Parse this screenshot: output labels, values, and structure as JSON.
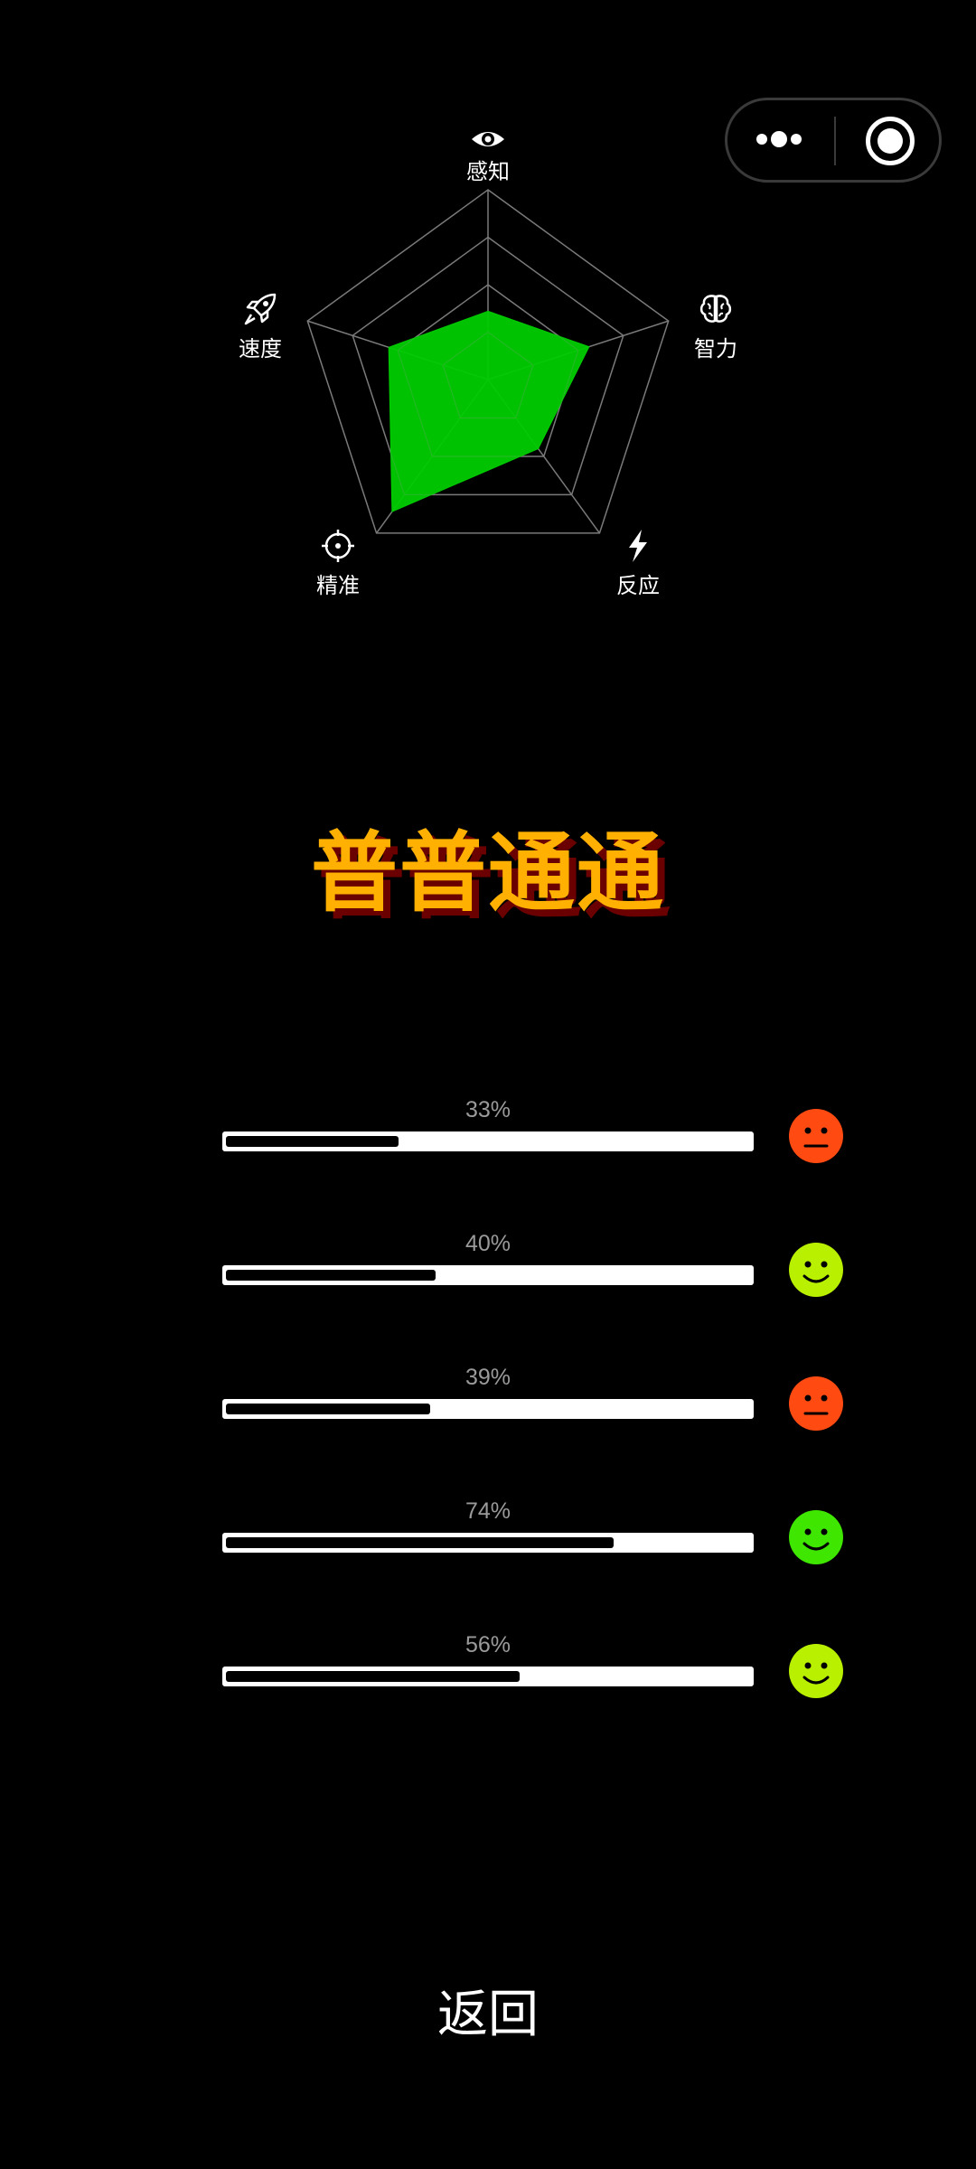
{
  "radar": {
    "axes": [
      {
        "label": "感知",
        "icon": "eye-icon",
        "value": 0.36
      },
      {
        "label": "智力",
        "icon": "brain-icon",
        "value": 0.56
      },
      {
        "label": "反应",
        "icon": "lightning-icon",
        "value": 0.45
      },
      {
        "label": "精准",
        "icon": "target-icon",
        "value": 0.86
      },
      {
        "label": "速度",
        "icon": "rocket-icon",
        "value": 0.55
      }
    ],
    "fill_color": "#00cc00",
    "grid_color": "#7a7a7a",
    "grid_levels": 4
  },
  "headline": "普普通通",
  "headline_color": "#ffb000",
  "rows": [
    {
      "percent_label": "33%",
      "value": 0.33,
      "mood": "neutral-face-icon",
      "mood_color": "#ff4a12"
    },
    {
      "percent_label": "40%",
      "value": 0.4,
      "mood": "smile-face-icon",
      "mood_color": "#b8f000"
    },
    {
      "percent_label": "39%",
      "value": 0.39,
      "mood": "neutral-face-icon",
      "mood_color": "#ff4a12"
    },
    {
      "percent_label": "74%",
      "value": 0.74,
      "mood": "smile-face-icon",
      "mood_color": "#3ee600"
    },
    {
      "percent_label": "56%",
      "value": 0.56,
      "mood": "smile-face-icon",
      "mood_color": "#b8f000"
    }
  ],
  "back_label": "返回"
}
